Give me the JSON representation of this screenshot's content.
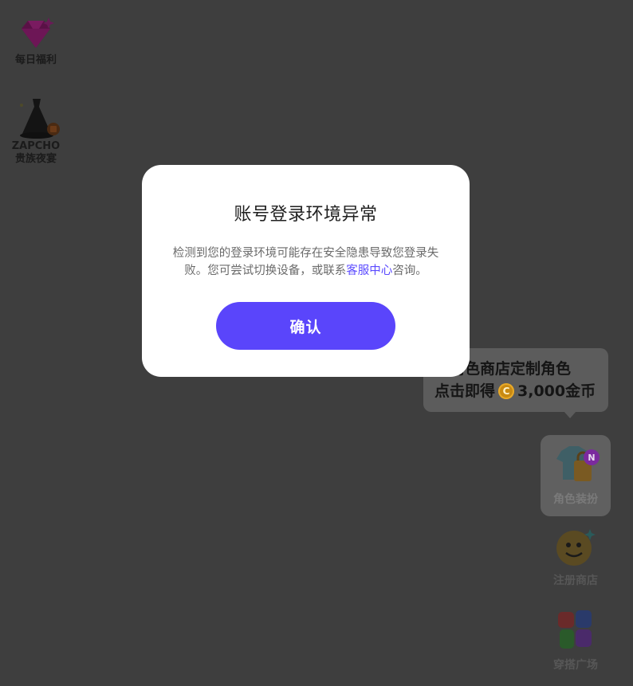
{
  "left_entries": {
    "daily": {
      "label": "每日福利",
      "icon": "diamond-gift-icon"
    },
    "night": {
      "brand": "ZAPCHO",
      "label": "贵族夜宴",
      "icon": "gown-icon"
    }
  },
  "modal": {
    "title": "账号登录环境异常",
    "body_prefix": "检测到您的登录环境可能存在安全隐患导致您登录失败。您可尝试切换设备，或联系",
    "body_link": "客服中心",
    "body_suffix": "咨询。",
    "confirm_label": "确认"
  },
  "tooltip": {
    "line1": "去角色商店定制角色",
    "line2_prefix": "点击即得",
    "coin_symbol": "C",
    "amount": "3,000金币"
  },
  "right_entries": {
    "dress": {
      "label": "角色装扮",
      "badge": "N",
      "icon": "tshirt-bag-icon"
    },
    "shop": {
      "label": "注册商店",
      "icon": "smiley-face-icon"
    },
    "square": {
      "label": "穿搭广场",
      "icon": "letter-blocks-icon"
    }
  },
  "colors": {
    "overlay_bg": "#3e3e3e",
    "accent": "#5a45fb",
    "link": "#5b4bff",
    "coin": "#c98a12"
  }
}
